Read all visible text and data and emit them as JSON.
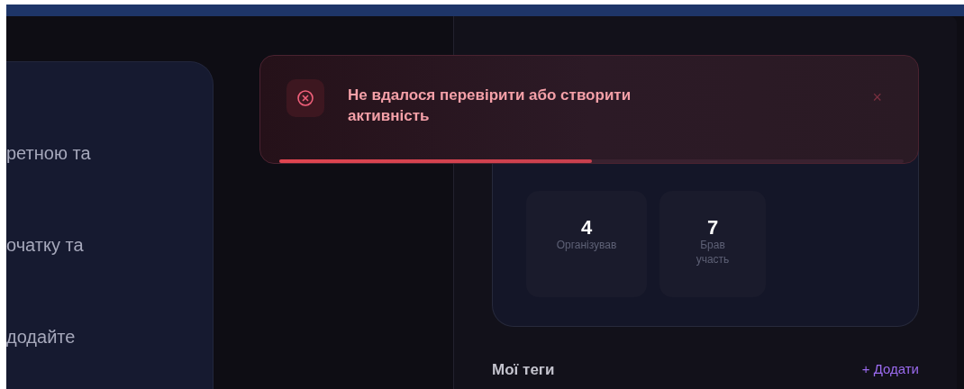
{
  "left_card": {
    "lines": [
      "ретною та",
      "очатку та",
      "додайте"
    ]
  },
  "stats": [
    {
      "value": "4",
      "label": "Організував"
    },
    {
      "value": "7",
      "label": "Брав участь"
    }
  ],
  "tags": {
    "title": "Мої теги",
    "add_link": "+ Додати"
  },
  "toast": {
    "message": "Не вдалося перевірити або створити активність",
    "close": "×",
    "level": 0.5
  }
}
